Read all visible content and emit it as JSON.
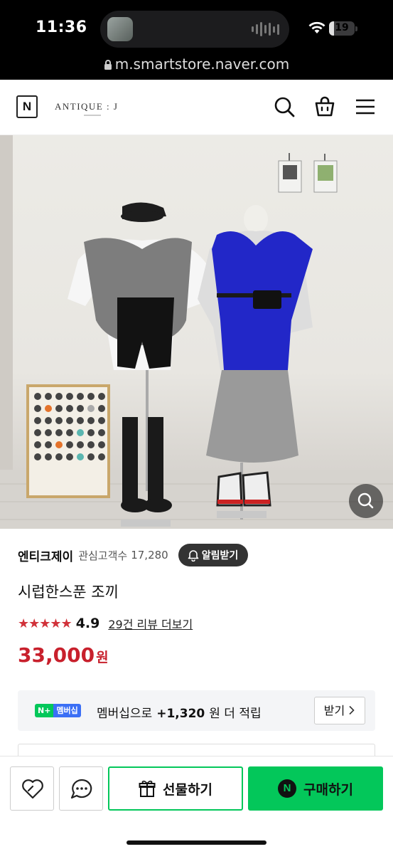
{
  "status_bar": {
    "time": "11:36",
    "battery": "19",
    "battery_fraction": 0.19
  },
  "browser": {
    "url": "m.smartstore.naver.com"
  },
  "header": {
    "logo": "N",
    "brand": "ANTIQUE : J",
    "icons": [
      "search-icon",
      "cart-icon",
      "menu-icon"
    ]
  },
  "product": {
    "store_name": "엔티크제이",
    "favorites_label": "관심고객수",
    "favorites_count": "17,280",
    "alert_button": "알림받기",
    "name": "시럽한스푼 조끼",
    "stars": "★★★★★",
    "rating": "4.9",
    "review_link": "29건 리뷰 더보기",
    "price": "33,000",
    "price_unit": "원"
  },
  "membership": {
    "badge_n": "N+",
    "badge_label": "멤버십",
    "text_prefix": "멤버십으로",
    "amount": "+1,320",
    "text_suffix": "원 더 적립",
    "button": "받기"
  },
  "bottom_bar": {
    "gift_button": "선물하기",
    "buy_button": "구매하기",
    "buy_logo": "N"
  },
  "colors": {
    "naver_green": "#03c75a",
    "price_red": "#c8202c",
    "star_red": "#d1323a"
  }
}
